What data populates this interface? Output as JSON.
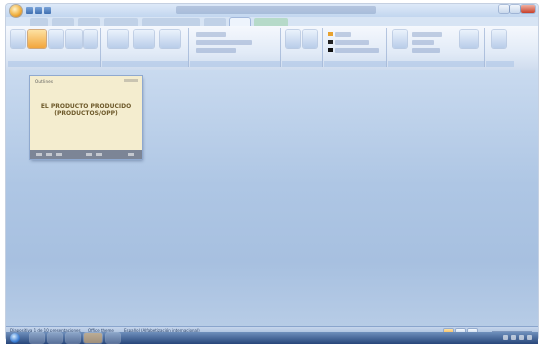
{
  "window": {
    "title": ""
  },
  "ribbon": {
    "tabs": [
      "",
      "",
      "",
      "",
      "",
      "",
      "",
      "",
      ""
    ],
    "active_tab_index": 7
  },
  "thumbnail": {
    "label": "Outlines",
    "heading": "EL PRODUCTO PRODUCIDO (PRODUCTOS/OPP)"
  },
  "statusbar": {
    "slide_info": "Diapositiva 1 de 10 presentaciones",
    "theme": "Office theme",
    "language": "Español (Alfabetización internacional)"
  },
  "colors": {
    "accent": "#f2a53c",
    "workspace": "#aec6e4",
    "slide_background": "#f4edcf"
  },
  "icons": {
    "office_button": "office-orb-icon",
    "start": "windows-start-icon"
  }
}
